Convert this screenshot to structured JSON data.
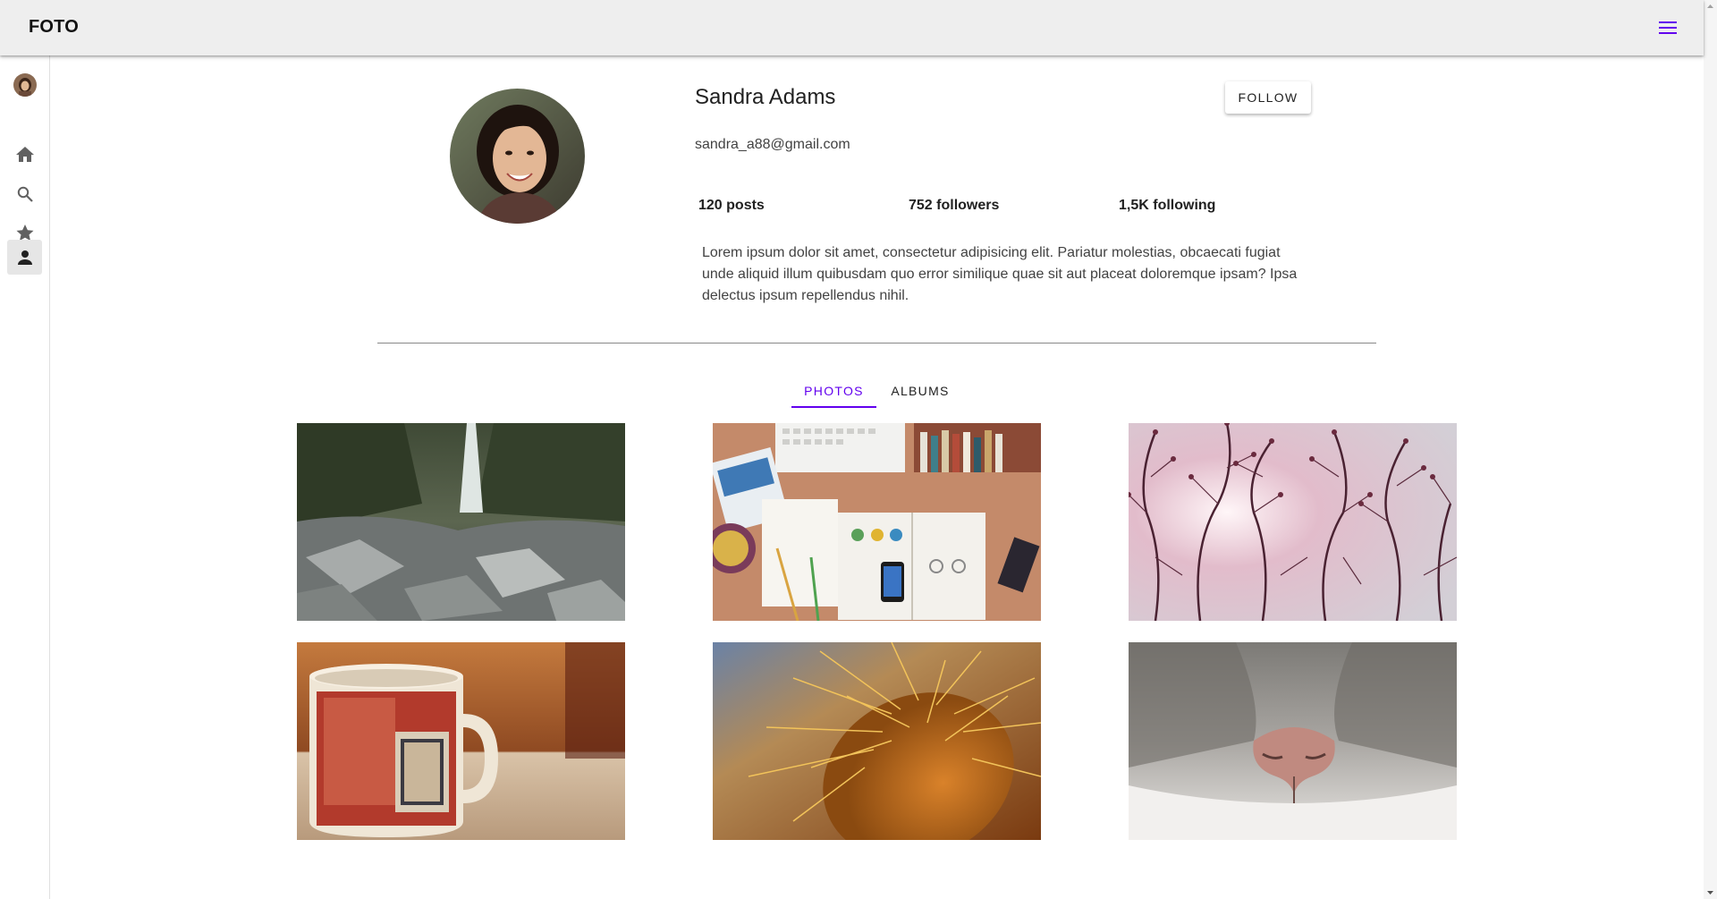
{
  "app": {
    "title": "FOTO"
  },
  "sidebar": {
    "items": [
      {
        "name": "home",
        "icon": "home-icon"
      },
      {
        "name": "search",
        "icon": "search-icon"
      },
      {
        "name": "favorites",
        "icon": "star-icon"
      },
      {
        "name": "profile",
        "icon": "person-icon",
        "active": true
      }
    ]
  },
  "profile": {
    "name": "Sandra Adams",
    "email": "sandra_a88@gmail.com",
    "follow_label": "FOLLOW",
    "stats": {
      "posts": "120 posts",
      "followers": "752 followers",
      "following": "1,5K following"
    },
    "bio": "Lorem ipsum dolor sit amet, consectetur adipisicing elit. Pariatur molestias, obcaecati fugiat unde aliquid illum quibusdam quo error similique quae sit aut placeat doloremque ipsam? Ipsa delectus ipsum repellendus nihil."
  },
  "tabs": [
    {
      "label": "PHOTOS",
      "active": true
    },
    {
      "label": "ALBUMS",
      "active": false
    }
  ],
  "photos": [
    {
      "subject": "waterfall-rocks"
    },
    {
      "subject": "desk-workspace"
    },
    {
      "subject": "tree-branches-sunlight"
    },
    {
      "subject": "red-coffee-mug"
    },
    {
      "subject": "cactus-spines"
    },
    {
      "subject": "cat-nose"
    }
  ],
  "colors": {
    "accent": "#6200ee",
    "appbar": "#eeeeee"
  }
}
